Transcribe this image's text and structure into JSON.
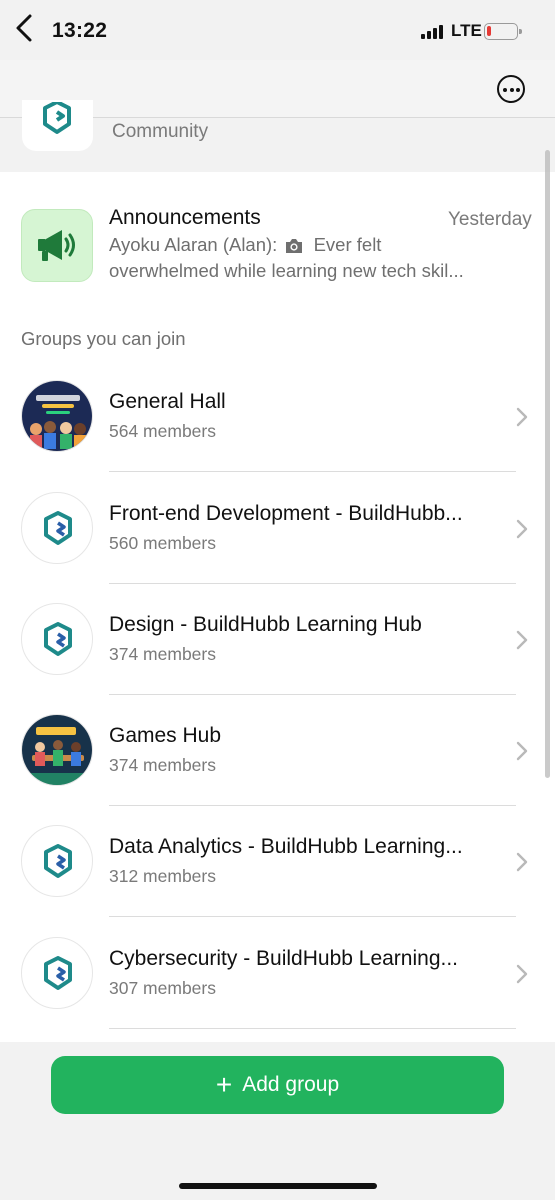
{
  "status_bar": {
    "time": "13:22",
    "network": "LTE",
    "battery_color": "#e53935"
  },
  "nav": {
    "back_icon": "chevron-left-icon",
    "more_icon": "ellipsis-circle-icon"
  },
  "community": {
    "label": "Community"
  },
  "announcements": {
    "title": "Announcements",
    "time": "Yesterday",
    "sender": "Ayoku Alaran (Alan):",
    "preview_start": "Ever felt",
    "preview_line2": "overwhelmed while learning new tech skil...",
    "icon": "megaphone-icon",
    "icon_bg": "#d6f5d3"
  },
  "section_title": "Groups you can join",
  "groups": [
    {
      "name": "General Hall",
      "members": "564 members",
      "avatar": "photo"
    },
    {
      "name": "Front-end Development - BuildHubb...",
      "members": "560 members",
      "avatar": "logo"
    },
    {
      "name": "Design - BuildHubb Learning Hub",
      "members": "374 members",
      "avatar": "logo"
    },
    {
      "name": "Games Hub",
      "members": "374 members",
      "avatar": "photo"
    },
    {
      "name": "Data Analytics - BuildHubb Learning...",
      "members": "312 members",
      "avatar": "logo"
    },
    {
      "name": "Cybersecurity - BuildHubb Learning...",
      "members": "307 members",
      "avatar": "logo"
    }
  ],
  "add_button": {
    "label": "Add group",
    "color": "#22b35e"
  },
  "colors": {
    "accent": "#22b35e",
    "brand_logo": "#1e8a8a"
  }
}
